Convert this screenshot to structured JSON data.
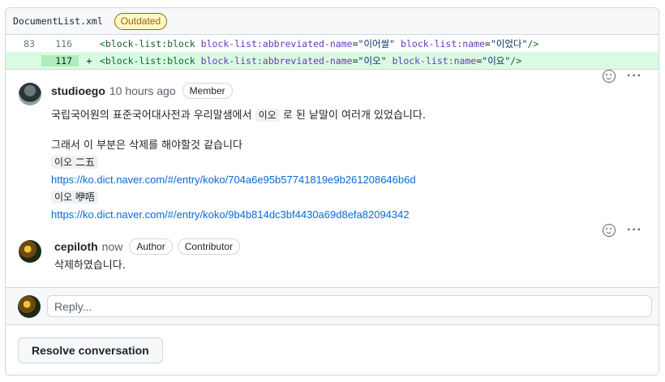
{
  "file": {
    "name": "DocumentList.xml",
    "badge": "Outdated"
  },
  "diff": {
    "rows": [
      {
        "old_line": "83",
        "new_line": "116",
        "marker": "",
        "tag_open": "<block-list:block",
        "attr1": "block-list:abbreviated-name",
        "val1": "\"이어쌀\"",
        "attr2": "block-list:name",
        "val2": "\"이었다\"",
        "tag_close": "/>"
      },
      {
        "old_line": "",
        "new_line": "117",
        "marker": "+",
        "tag_open": "<block-list:block",
        "attr1": "block-list:abbreviated-name",
        "val1": "\"이오\"",
        "attr2": "block-list:name",
        "val2": "\"이요\"",
        "tag_close": "/>"
      }
    ]
  },
  "comments": [
    {
      "author": "studioego",
      "time": "10 hours ago",
      "badges": [
        "Member"
      ],
      "line1_pre": "국립국어원의 표준국어대사전과 우리말샘에서",
      "line1_chip": "이오",
      "line1_post": "로 된 낱말이 여러개 있었습니다.",
      "line2": "그래서 이 부분은 삭제를 해야할것 같습니다",
      "chip1": "이오 二五",
      "link1": "https://ko.dict.naver.com/#/entry/koko/704a6e95b57741819e9b261208646b6d",
      "chip2": "이오 咿唔",
      "link2": "https://ko.dict.naver.com/#/entry/koko/9b4b814dc3bf4430a69d8efa82094342"
    },
    {
      "author": "cepiloth",
      "time": "now",
      "badges": [
        "Author",
        "Contributor"
      ],
      "text": "삭제하였습니다."
    }
  ],
  "reply": {
    "placeholder": "Reply..."
  },
  "resolve_label": "Resolve conversation"
}
